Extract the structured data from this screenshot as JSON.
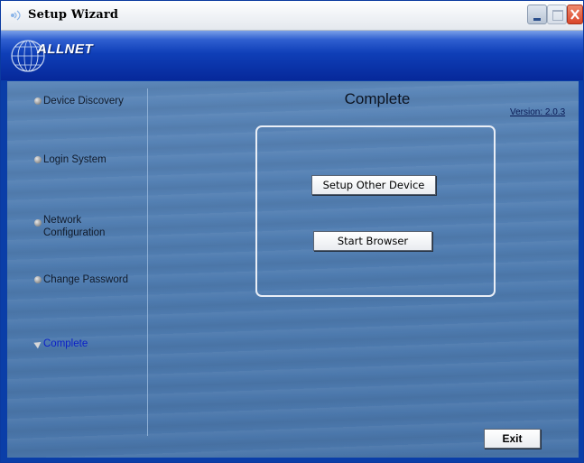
{
  "window": {
    "title": "Setup Wizard"
  },
  "banner": {
    "brand": "ALLNET"
  },
  "sidebar": {
    "items": [
      {
        "label": "Device Discovery",
        "active": false
      },
      {
        "label": "Login System",
        "active": false
      },
      {
        "label": "Network Configuration",
        "active": false
      },
      {
        "label": "Change Password",
        "active": false
      },
      {
        "label": "Complete",
        "active": true
      }
    ]
  },
  "main": {
    "title": "Complete",
    "version": "Version: 2.0.3",
    "setup_other_label": "Setup Other Device",
    "start_browser_label": "Start Browser",
    "exit_label": "Exit"
  },
  "colors": {
    "banner": "#0f3fb8",
    "content_background": "#4f7cb0",
    "active_nav": "#0b1fc8",
    "close_button": "#d9452a"
  },
  "icons": [
    "app-icon",
    "minimize-icon",
    "maximize-icon",
    "close-icon",
    "allnet-logo"
  ]
}
